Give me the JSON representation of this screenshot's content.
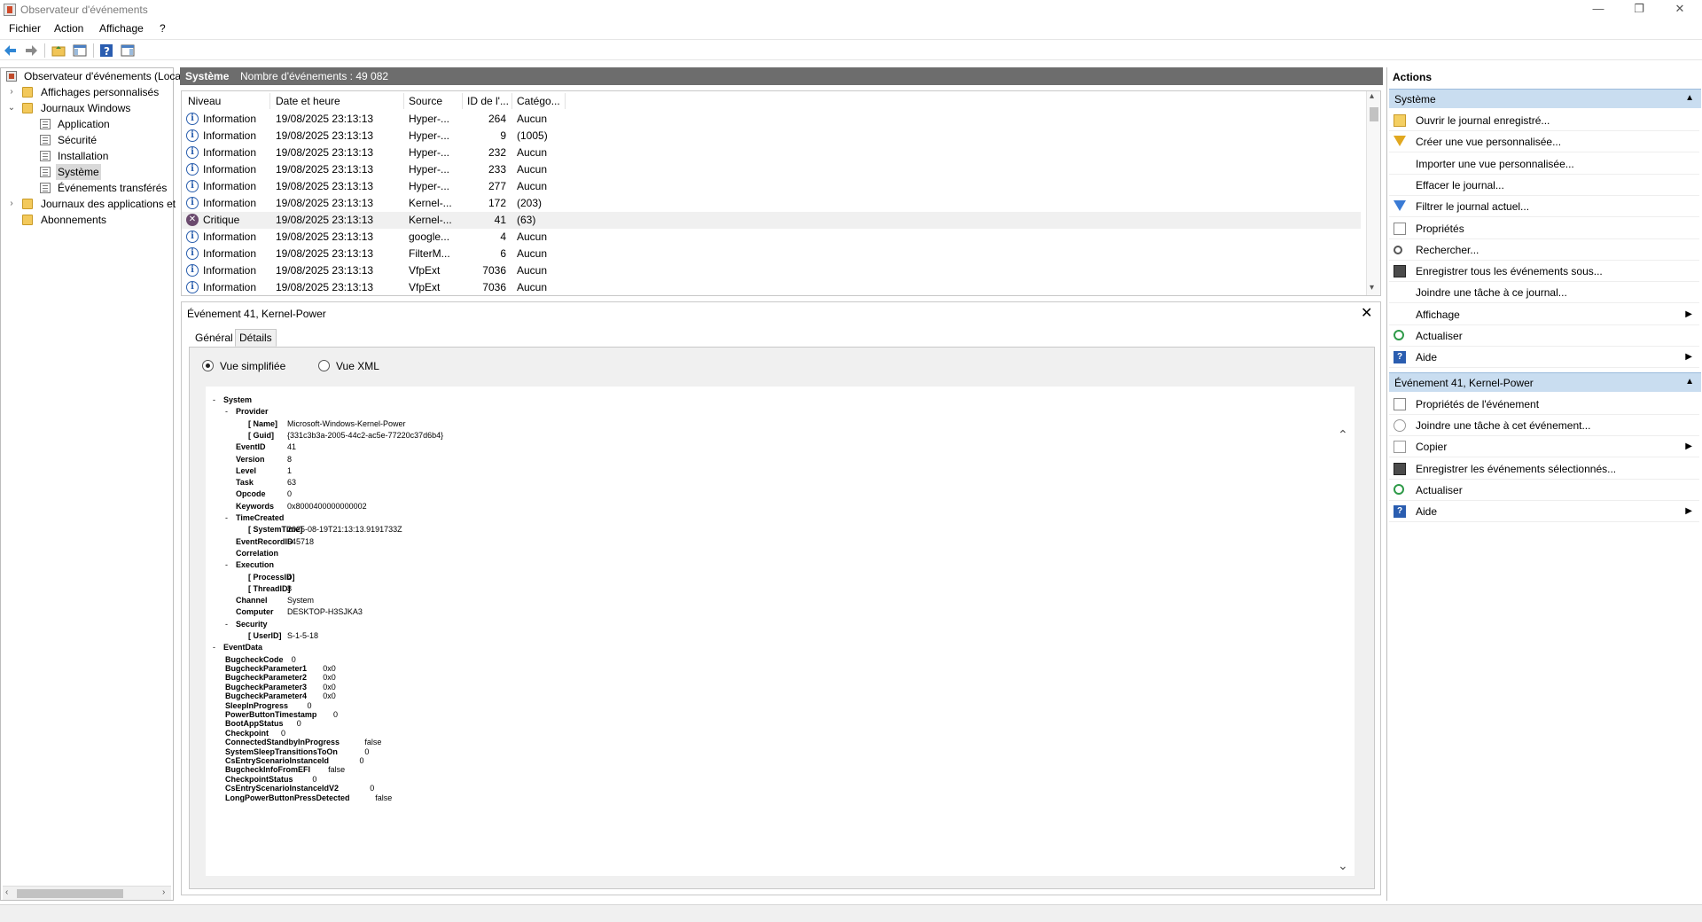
{
  "window": {
    "title": "Observateur d'événements",
    "minimize": "—",
    "restore": "❐",
    "close": "✕"
  },
  "menu": [
    "Fichier",
    "Action",
    "Affichage",
    "?"
  ],
  "toolbar_icons": [
    "back-arrow-icon",
    "forward-arrow-icon",
    "up-folder-icon",
    "show-hide-tree-icon",
    "help-icon",
    "show-hide-actions-icon"
  ],
  "tree": {
    "root": "Observateur d'événements (Local)",
    "custom_views": "Affichages personnalisés",
    "windows_logs": "Journaux Windows",
    "application": "Application",
    "security": "Sécurité",
    "setup": "Installation",
    "system": "Système",
    "forwarded": "Événements transférés",
    "app_logs": "Journaux des applications et",
    "subscriptions": "Abonnements"
  },
  "center": {
    "log_name": "Système",
    "count_label": "Nombre d'événements : 49 082"
  },
  "event_list": {
    "columns": [
      "Niveau",
      "Date et heure",
      "Source",
      "ID de l'...",
      "Catégo..."
    ],
    "rows": [
      {
        "level": "Information",
        "date": "19/08/2025 23:13:13",
        "source": "Hyper-...",
        "id": "264",
        "category": "Aucun"
      },
      {
        "level": "Information",
        "date": "19/08/2025 23:13:13",
        "source": "Hyper-...",
        "id": "9",
        "category": "(1005)"
      },
      {
        "level": "Information",
        "date": "19/08/2025 23:13:13",
        "source": "Hyper-...",
        "id": "232",
        "category": "Aucun"
      },
      {
        "level": "Information",
        "date": "19/08/2025 23:13:13",
        "source": "Hyper-...",
        "id": "233",
        "category": "Aucun"
      },
      {
        "level": "Information",
        "date": "19/08/2025 23:13:13",
        "source": "Hyper-...",
        "id": "277",
        "category": "Aucun"
      },
      {
        "level": "Information",
        "date": "19/08/2025 23:13:13",
        "source": "Kernel-...",
        "id": "172",
        "category": "(203)"
      },
      {
        "level": "Critique",
        "date": "19/08/2025 23:13:13",
        "source": "Kernel-...",
        "id": "41",
        "category": "(63)"
      },
      {
        "level": "Information",
        "date": "19/08/2025 23:13:13",
        "source": "google...",
        "id": "4",
        "category": "Aucun"
      },
      {
        "level": "Information",
        "date": "19/08/2025 23:13:13",
        "source": "FilterM...",
        "id": "6",
        "category": "Aucun"
      },
      {
        "level": "Information",
        "date": "19/08/2025 23:13:13",
        "source": "VfpExt",
        "id": "7036",
        "category": "Aucun"
      },
      {
        "level": "Information",
        "date": "19/08/2025 23:13:13",
        "source": "VfpExt",
        "id": "7036",
        "category": "Aucun"
      }
    ],
    "selected_index": 6
  },
  "detail": {
    "title": "Événement 41, Kernel-Power",
    "close": "✕",
    "tabs": [
      "Général",
      "Détails"
    ],
    "active_tab": "Détails",
    "radio_friendly": "Vue simplifiée",
    "radio_xml": "Vue XML",
    "xml": [
      {
        "indent": 0,
        "toggle": "-",
        "key": "System",
        "value": ""
      },
      {
        "indent": 1,
        "toggle": "-",
        "key": "Provider",
        "value": ""
      },
      {
        "indent": 2,
        "toggle": "",
        "key": "[ Name]",
        "value": "Microsoft-Windows-Kernel-Power"
      },
      {
        "indent": 2,
        "toggle": "",
        "key": "[ Guid]",
        "value": "{331c3b3a-2005-44c2-ac5e-77220c37d6b4}"
      },
      {
        "indent": 1,
        "toggle": "",
        "key": "EventID",
        "value": "41"
      },
      {
        "indent": 1,
        "toggle": "",
        "key": "Version",
        "value": "8"
      },
      {
        "indent": 1,
        "toggle": "",
        "key": "Level",
        "value": "1"
      },
      {
        "indent": 1,
        "toggle": "",
        "key": "Task",
        "value": "63"
      },
      {
        "indent": 1,
        "toggle": "",
        "key": "Opcode",
        "value": "0"
      },
      {
        "indent": 1,
        "toggle": "",
        "key": "Keywords",
        "value": "0x8000400000000002"
      },
      {
        "indent": 1,
        "toggle": "-",
        "key": "TimeCreated",
        "value": ""
      },
      {
        "indent": 2,
        "toggle": "",
        "key": "[ SystemTime]",
        "value": "2025-08-19T21:13:13.9191733Z"
      },
      {
        "indent": 1,
        "toggle": "",
        "key": "EventRecordID",
        "value": "545718"
      },
      {
        "indent": 1,
        "toggle": "",
        "key": "Correlation",
        "value": ""
      },
      {
        "indent": 1,
        "toggle": "-",
        "key": "Execution",
        "value": ""
      },
      {
        "indent": 2,
        "toggle": "",
        "key": "[ ProcessID]",
        "value": "4"
      },
      {
        "indent": 2,
        "toggle": "",
        "key": "[ ThreadID]",
        "value": "8"
      },
      {
        "indent": 1,
        "toggle": "",
        "key": "Channel",
        "value": "System"
      },
      {
        "indent": 1,
        "toggle": "",
        "key": "Computer",
        "value": "DESKTOP-H3SJKA3"
      },
      {
        "indent": 1,
        "toggle": "-",
        "key": "Security",
        "value": ""
      },
      {
        "indent": 2,
        "toggle": "",
        "key": "[ UserID]",
        "value": "S-1-5-18"
      },
      {
        "indent": 0,
        "toggle": "-",
        "key": "EventData",
        "value": ""
      }
    ],
    "eventdata": [
      {
        "key": "BugcheckCode",
        "value": "0"
      },
      {
        "key": "BugcheckParameter1",
        "value": "0x0"
      },
      {
        "key": "BugcheckParameter2",
        "value": "0x0"
      },
      {
        "key": "BugcheckParameter3",
        "value": "0x0"
      },
      {
        "key": "BugcheckParameter4",
        "value": "0x0"
      },
      {
        "key": "SleepInProgress",
        "value": "0"
      },
      {
        "key": "PowerButtonTimestamp",
        "value": "0"
      },
      {
        "key": "BootAppStatus",
        "value": "0"
      },
      {
        "key": "Checkpoint",
        "value": "0"
      },
      {
        "key": "ConnectedStandbyInProgress",
        "value": "false"
      },
      {
        "key": "SystemSleepTransitionsToOn",
        "value": "0"
      },
      {
        "key": "CsEntryScenarioInstanceId",
        "value": "0"
      },
      {
        "key": "BugcheckInfoFromEFI",
        "value": "false"
      },
      {
        "key": "CheckpointStatus",
        "value": "0"
      },
      {
        "key": "CsEntryScenarioInstanceIdV2",
        "value": "0"
      },
      {
        "key": "LongPowerButtonPressDetected",
        "value": "false"
      }
    ]
  },
  "actions": {
    "title": "Actions",
    "section1": "Système",
    "section1_items": [
      {
        "label": "Ouvrir le journal enregistré...",
        "icon": "open-folder-icon",
        "submenu": false
      },
      {
        "label": "Créer une vue personnalisée...",
        "icon": "filter-create-icon",
        "submenu": false
      },
      {
        "label": "Importer une vue personnalisée...",
        "icon": "",
        "submenu": false
      },
      {
        "label": "Effacer le journal...",
        "icon": "",
        "submenu": false
      },
      {
        "label": "Filtrer le journal actuel...",
        "icon": "filter-icon",
        "submenu": false
      },
      {
        "label": "Propriétés",
        "icon": "properties-icon",
        "submenu": false
      },
      {
        "label": "Rechercher...",
        "icon": "find-icon",
        "submenu": false
      },
      {
        "label": "Enregistrer tous les événements sous...",
        "icon": "save-icon",
        "submenu": false
      },
      {
        "label": "Joindre une tâche à ce journal...",
        "icon": "",
        "submenu": false
      },
      {
        "label": "Affichage",
        "icon": "",
        "submenu": true
      },
      {
        "label": "Actualiser",
        "icon": "refresh-icon",
        "submenu": false
      },
      {
        "label": "Aide",
        "icon": "help-icon",
        "submenu": true
      }
    ],
    "section2": "Événement 41, Kernel-Power",
    "section2_items": [
      {
        "label": "Propriétés de l'événement",
        "icon": "properties-icon",
        "submenu": false
      },
      {
        "label": "Joindre une tâche à cet événement...",
        "icon": "task-icon",
        "submenu": false
      },
      {
        "label": "Copier",
        "icon": "copy-icon",
        "submenu": true
      },
      {
        "label": "Enregistrer les événements sélectionnés...",
        "icon": "save-icon",
        "submenu": false
      },
      {
        "label": "Actualiser",
        "icon": "refresh-icon",
        "submenu": false
      },
      {
        "label": "Aide",
        "icon": "help-icon",
        "submenu": true
      }
    ]
  }
}
